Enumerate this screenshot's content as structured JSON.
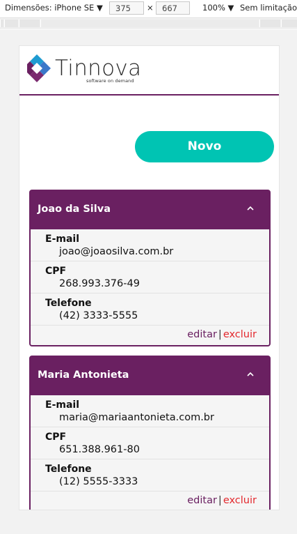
{
  "devtools": {
    "dimensions_label": "Dimensões: iPhone SE",
    "dropdown_caret": "▼",
    "width": "375",
    "times": "×",
    "height": "667",
    "zoom": "100%",
    "zoom_caret": "▼",
    "throttle": "Sem limitação"
  },
  "header": {
    "logo_text": "Tinnova",
    "logo_tagline": "software on demand"
  },
  "toolbar": {
    "new_label": "Novo"
  },
  "contacts": [
    {
      "name": "Joao da Silva",
      "email_label": "E-mail",
      "email": "joao@joaosilva.com.br",
      "cpf_label": "CPF",
      "cpf": "268.993.376-49",
      "phone_label": "Telefone",
      "phone": "(42) 3333-5555",
      "edit_label": "editar",
      "separator": "|",
      "delete_label": "excluir"
    },
    {
      "name": "Maria Antonieta",
      "email_label": "E-mail",
      "email": "maria@mariaantonieta.com.br",
      "cpf_label": "CPF",
      "cpf": "651.388.961-80",
      "phone_label": "Telefone",
      "phone": "(12) 5555-3333",
      "edit_label": "editar",
      "separator": "|",
      "delete_label": "excluir"
    }
  ],
  "colors": {
    "brand_purple": "#6a2061",
    "accent_teal": "#00c4b3",
    "delete_red": "#e3282d"
  }
}
